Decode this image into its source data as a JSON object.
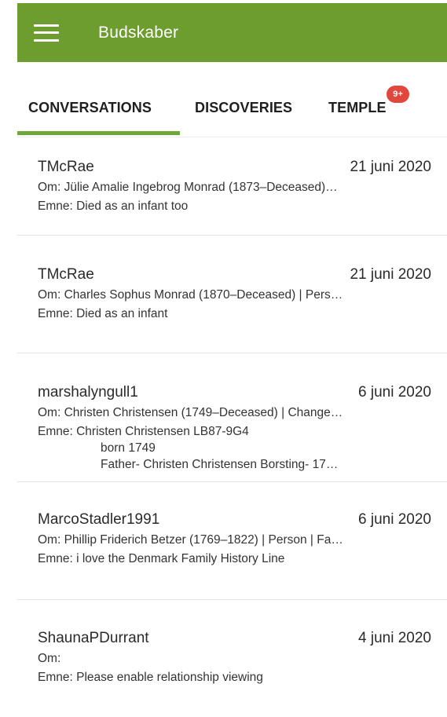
{
  "appbar": {
    "title": "Budskaber"
  },
  "tabs": [
    {
      "label": "CONVERSATIONS",
      "active": true
    },
    {
      "label": "DISCOVERIES",
      "active": false
    },
    {
      "label": "TEMPLE",
      "active": false,
      "badge": "9+"
    }
  ],
  "colors": {
    "appbar": "#6d9d2f",
    "indicator": "#6fa83a",
    "badge": "#e2473d"
  },
  "conversations": [
    {
      "sender": "TMcRae",
      "date": "21 juni 2020",
      "about": "Om: Jülie Amalie Ingebrog Monrad (1873–Deceased)…",
      "subject": "Emne: Died as an infant too"
    },
    {
      "sender": "TMcRae",
      "date": "21 juni 2020",
      "about": "Om: Charles Sophus Monrad (1870–Deceased) | Pers…",
      "subject": "Emne: Died as an infant"
    },
    {
      "sender": "marshalyngull1",
      "date": "6 juni 2020",
      "about": "Om: Christen Christensen (1749–Deceased) | Change…",
      "subject": "Emne: Christen Christensen LB87-9G4",
      "subject_line2": "born 1749",
      "subject_line3": "Father- Christen Christensen Borsting- 17…"
    },
    {
      "sender": "MarcoStadler1991",
      "date": "6 juni 2020",
      "about": "Om: Phillip Friderich Betzer (1769–1822) | Person | Fa…",
      "subject": "Emne: i love the Denmark Family History Line"
    },
    {
      "sender": "ShaunaPDurrant",
      "date": "4 juni 2020",
      "about": "Om:",
      "subject": "Emne: Please enable relationship viewing"
    }
  ]
}
